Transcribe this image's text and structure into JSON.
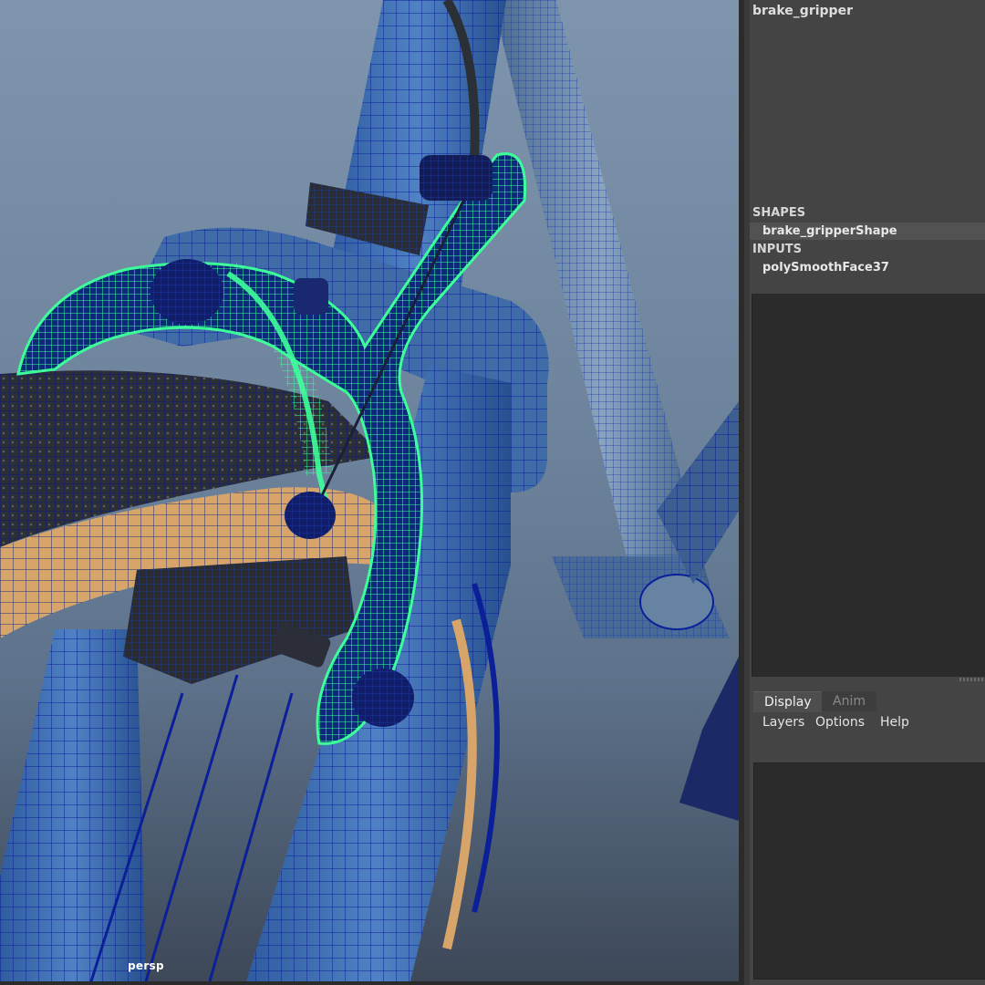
{
  "viewport": {
    "camera_label": "persp"
  },
  "channel_box": {
    "object_name": "brake_gripper",
    "shapes_header": "SHAPES",
    "shape_node": "brake_gripperShape",
    "inputs_header": "INPUTS",
    "input_node": "polySmoothFace37"
  },
  "layer_editor": {
    "tabs": [
      {
        "label": "Display",
        "active": true
      },
      {
        "label": "Anim",
        "active": false
      }
    ],
    "menus": [
      "Layers",
      "Options",
      "Help"
    ]
  },
  "colors": {
    "selection_highlight": "#3dff9a",
    "wireframe": "#0a1a8c",
    "panel_bg": "#444444",
    "panel_dark": "#2b2b2b"
  }
}
